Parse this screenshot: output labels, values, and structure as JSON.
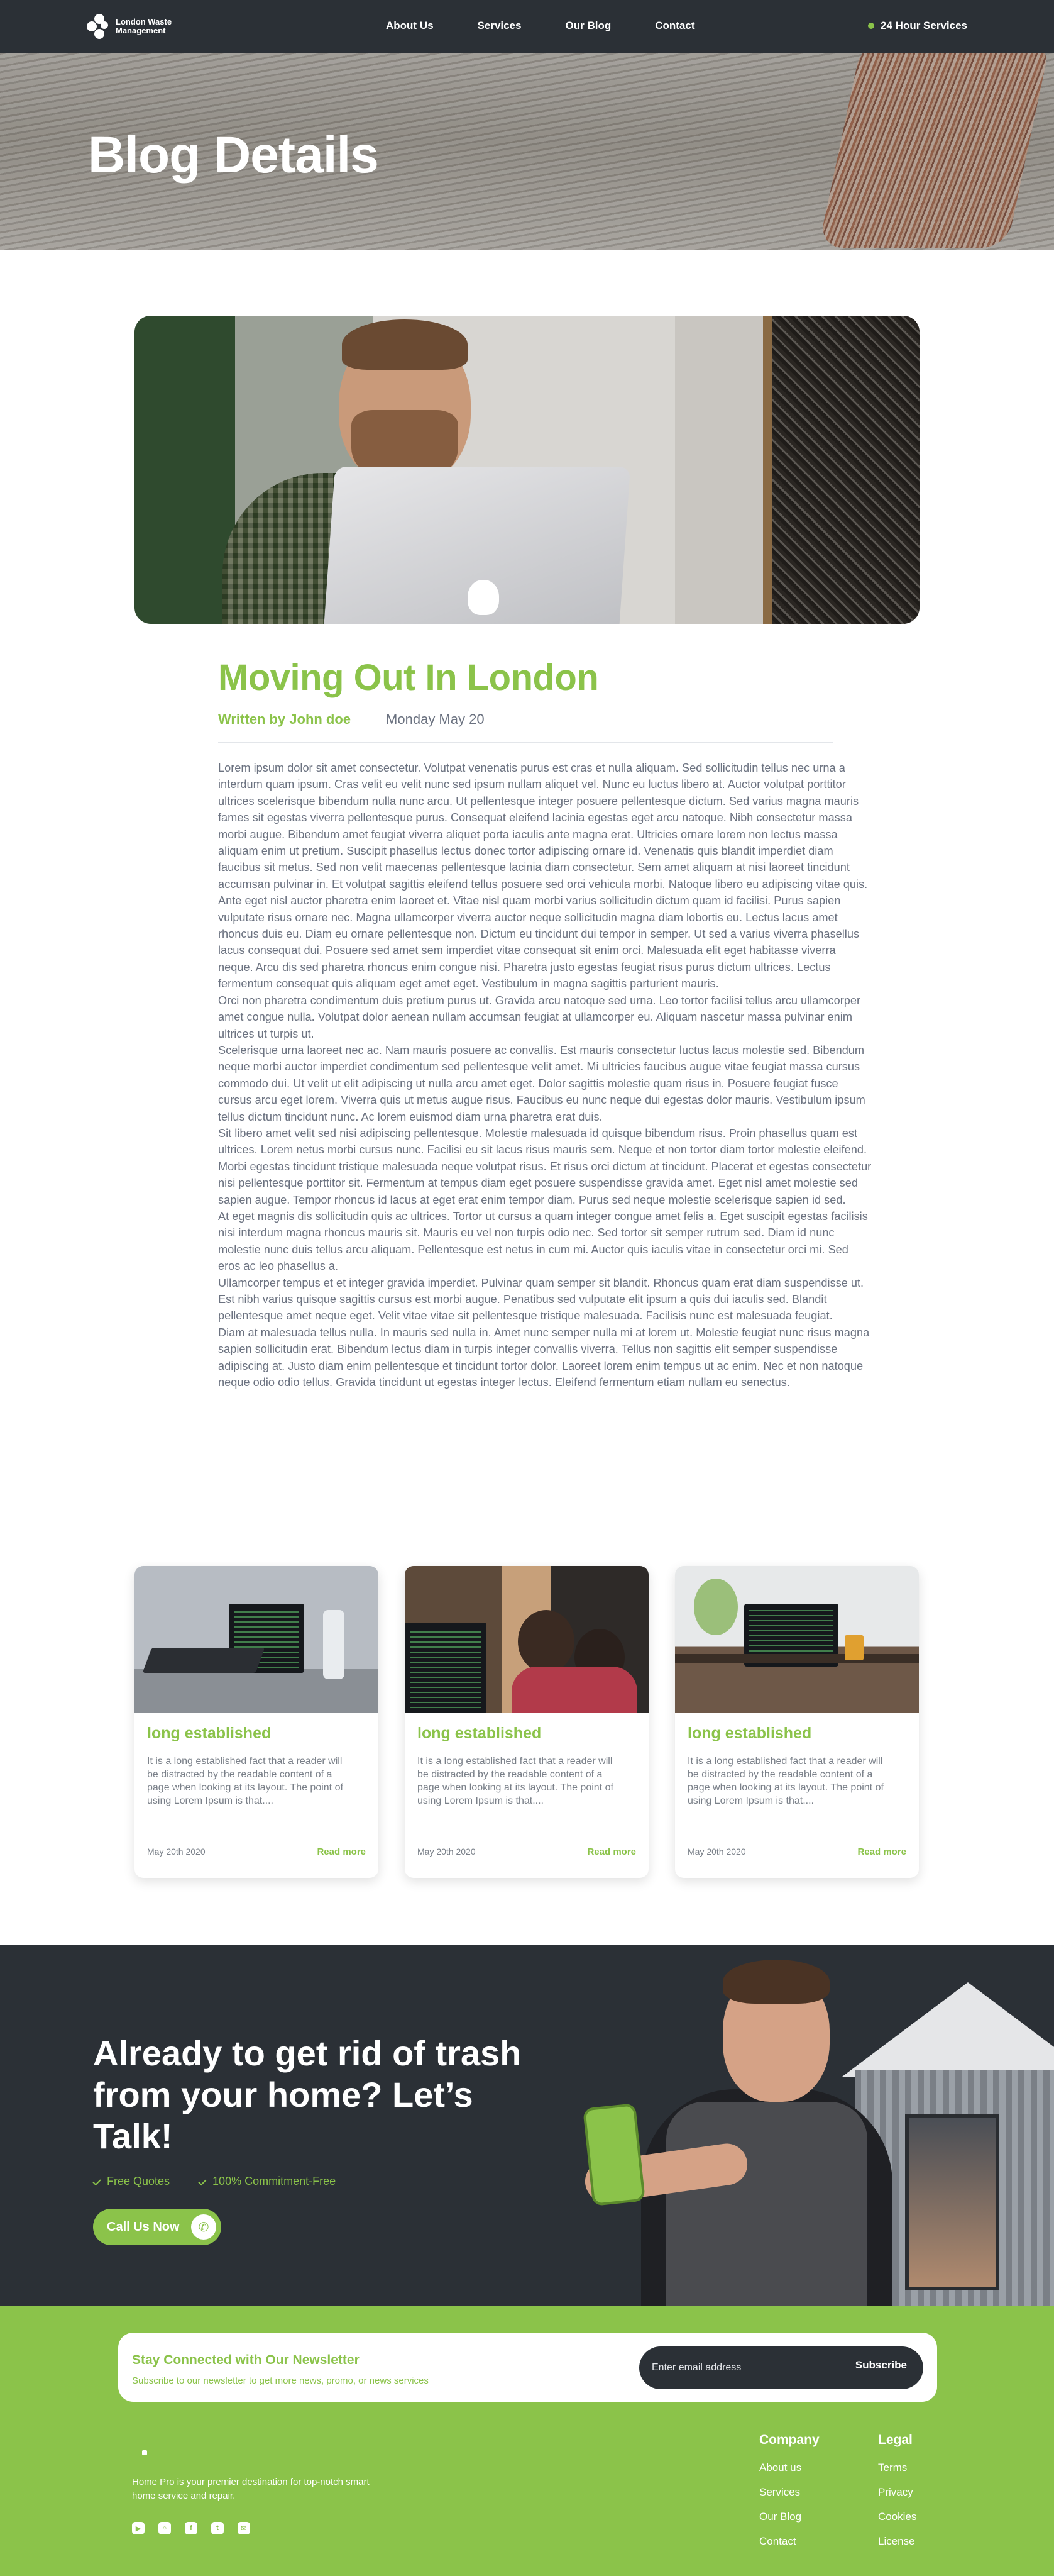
{
  "nav": {
    "brand": "London Waste Management",
    "links": [
      "About Us",
      "Services",
      "Our Blog",
      "Contact"
    ],
    "status": "24 Hour Services",
    "accent": "#8bc34a"
  },
  "hero": {
    "title": "Blog Details"
  },
  "article": {
    "title": "Moving Out In London",
    "author": "Written by John doe",
    "date": "Monday May 20",
    "paragraphs": [
      "Lorem ipsum dolor sit amet consectetur. Volutpat venenatis purus est cras et nulla aliquam. Sed sollicitudin tellus nec urna a interdum quam ipsum. Cras velit eu velit nunc sed ipsum nullam aliquet vel. Nunc eu luctus libero at. Auctor volutpat porttitor ultrices scelerisque bibendum nulla nunc arcu. Ut pellentesque integer posuere pellentesque dictum. Sed varius magna mauris fames sit egestas viverra pellentesque purus. Consequat eleifend lacinia egestas eget arcu natoque. Nibh consectetur massa morbi augue. Bibendum amet feugiat viverra aliquet porta iaculis ante magna erat. Ultricies ornare lorem non lectus massa aliquam enim ut pretium. Suscipit phasellus lectus donec tortor adipiscing ornare id. Venenatis quis blandit imperdiet diam faucibus sit metus. Sed non velit maecenas pellentesque lacinia diam consectetur. Sem amet aliquam at nisi laoreet tincidunt accumsan pulvinar in. Et volutpat sagittis eleifend tellus posuere sed orci vehicula morbi. Natoque libero eu adipiscing vitae quis. Ante eget nisl auctor pharetra enim laoreet et. Vitae nisl quam morbi varius sollicitudin dictum quam id facilisi. Purus sapien vulputate risus ornare nec. Magna ullamcorper viverra auctor neque sollicitudin magna diam lobortis eu. Lectus lacus amet rhoncus duis eu. Diam eu ornare pellentesque non. Dictum eu tincidunt dui tempor in semper. Ut sed a varius viverra phasellus lacus consequat dui. Posuere sed amet sem imperdiet vitae consequat sit enim orci. Malesuada elit eget habitasse viverra neque. Arcu dis sed pharetra rhoncus enim congue nisi. Pharetra justo egestas feugiat risus purus dictum ultrices. Lectus fermentum consequat quis aliquam eget amet eget. Vestibulum in magna sagittis parturient mauris.",
      "Orci non pharetra condimentum duis pretium purus ut. Gravida arcu natoque sed urna. Leo tortor facilisi tellus arcu ullamcorper amet congue nulla. Volutpat dolor aenean nullam accumsan feugiat at ullamcorper eu. Aliquam nascetur massa pulvinar enim ultrices ut turpis ut.",
      "Scelerisque urna laoreet nec ac. Nam mauris posuere ac convallis. Est mauris consectetur luctus lacus molestie sed. Bibendum neque morbi auctor imperdiet condimentum sed pellentesque velit amet. Mi ultricies faucibus augue vitae feugiat massa cursus commodo dui. Ut velit ut elit adipiscing ut nulla arcu amet eget. Dolor sagittis molestie quam risus in. Posuere feugiat fusce cursus arcu eget lorem. Viverra quis ut metus augue risus. Faucibus eu nunc neque dui egestas dolor mauris. Vestibulum ipsum tellus dictum tincidunt nunc. Ac lorem euismod diam urna pharetra erat duis.",
      "Sit libero amet velit sed nisi adipiscing pellentesque. Molestie malesuada id quisque bibendum risus. Proin phasellus quam est ultrices. Lorem netus morbi cursus nunc. Facilisi eu sit lacus risus mauris sem. Neque et non tortor diam tortor molestie eleifend. Morbi egestas tincidunt tristique malesuada neque volutpat risus. Et risus orci dictum at tincidunt. Placerat et egestas consectetur nisi pellentesque porttitor sit. Fermentum at tempus diam eget posuere suspendisse gravida amet. Eget nisl amet molestie sed sapien augue. Tempor rhoncus id lacus at eget erat enim tempor diam. Purus sed neque molestie scelerisque sapien id sed.",
      "At eget magnis dis sollicitudin quis ac ultrices. Tortor ut cursus a quam integer congue amet felis a. Eget suscipit egestas facilisis nisi interdum magna rhoncus mauris sit. Mauris eu vel non turpis odio nec. Sed tortor sit semper rutrum sed. Diam id nunc molestie nunc duis tellus arcu aliquam. Pellentesque est netus in cum mi. Auctor quis iaculis vitae in consectetur orci mi. Sed eros ac leo phasellus a.",
      "Ullamcorper tempus et et integer gravida imperdiet. Pulvinar quam semper sit blandit. Rhoncus quam erat diam suspendisse ut. Est nibh varius quisque sagittis cursus est morbi augue. Penatibus sed vulputate elit ipsum a quis dui iaculis sed. Blandit pellentesque amet neque eget. Velit vitae vitae sit pellentesque tristique malesuada. Facilisis nunc est malesuada feugiat.",
      "Diam at malesuada tellus nulla. In mauris sed nulla in. Amet nunc semper nulla mi at lorem ut. Molestie feugiat nunc risus magna sapien sollicitudin erat. Bibendum lectus diam in turpis integer convallis viverra. Tellus non sagittis elit semper suspendisse adipiscing at. Justo diam enim pellentesque et tincidunt tortor dolor. Laoreet lorem enim tempus ut ac enim. Nec et non natoque neque odio odio tellus. Gravida tincidunt ut egestas integer lectus. Eleifend fermentum etiam nullam eu senectus."
    ]
  },
  "cards": [
    {
      "title": "long established",
      "text": "It is a long established fact that a reader will be distracted by the readable content of a page when looking at its layout. The point of using Lorem Ipsum is that....",
      "date": "May 20th 2020",
      "link": "Read more"
    },
    {
      "title": "long established",
      "text": "It is a long established fact that a reader will be distracted by the readable content of a page when looking at its layout. The point of using Lorem Ipsum is that....",
      "date": "May 20th 2020",
      "link": "Read more"
    },
    {
      "title": "long established",
      "text": "It is a long established fact that a reader will be distracted by the readable content of a page when looking at its layout. The point of using Lorem Ipsum is that....",
      "date": "May 20th 2020",
      "link": "Read more"
    }
  ],
  "cta": {
    "title": "Already to get rid of trash from your home? Let’s Talk!",
    "checks": [
      "Free Quotes",
      "100% Commitment-Free"
    ],
    "button": "Call Us Now"
  },
  "newsletter": {
    "title": "Stay Connected with Our Newsletter",
    "subtitle": "Subscribe to our newsletter to get more news, promo, or news services",
    "placeholder": "Enter email address",
    "button": "Subscribe"
  },
  "footer": {
    "description": "Home Pro is your premier destination for top-notch smart home service and repair.",
    "socials": [
      "youtube-icon",
      "instagram-icon",
      "facebook-icon",
      "twitter-icon",
      "mail-icon"
    ],
    "company": {
      "heading": "Company",
      "links": [
        "About us",
        "Services",
        "Our Blog",
        "Contact"
      ]
    },
    "legal": {
      "heading": "Legal",
      "links": [
        "Terms",
        "Privacy",
        "Cookies",
        "License"
      ]
    }
  }
}
